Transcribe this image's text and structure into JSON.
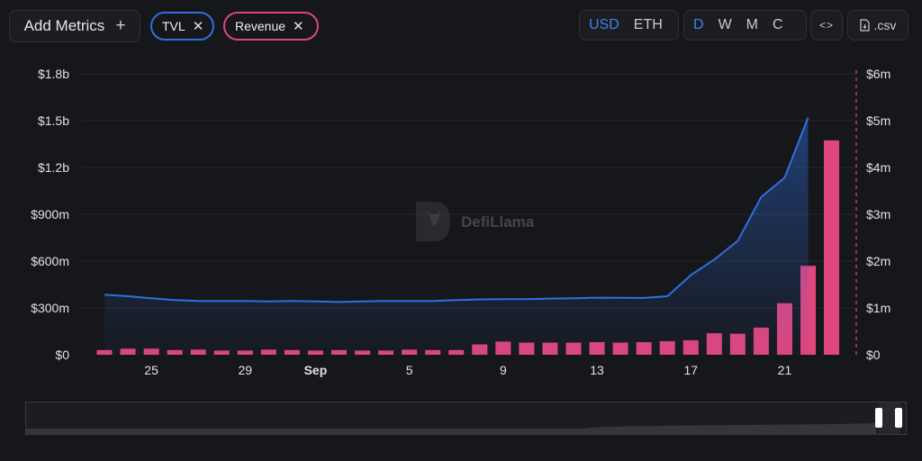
{
  "toolbar": {
    "add_metrics_label": "Add Metrics",
    "plus_glyph": "+",
    "metric_pills": [
      {
        "label": "TVL",
        "color": "#2f6fe0",
        "close": "✕"
      },
      {
        "label": "Revenue",
        "color": "#e0457b",
        "close": "✕"
      }
    ],
    "currency": {
      "options": [
        "USD",
        "ETH"
      ],
      "selected": "USD"
    },
    "period": {
      "options": [
        "D",
        "W",
        "M",
        "C"
      ],
      "selected": "D"
    },
    "embed_label": "<>",
    "csv_label": ".csv"
  },
  "watermark": "DefiLlama",
  "colors": {
    "tvl_line": "#2f6fe0",
    "revenue_bar": "#e0457b",
    "background": "#16171b",
    "grid": "#26272b"
  },
  "chart_data": {
    "type": "bar+line",
    "x_tick_labels": [
      "25",
      "29",
      "Sep",
      "5",
      "9",
      "13",
      "17",
      "21"
    ],
    "y_left": {
      "ticks": [
        "$0",
        "$300m",
        "$600m",
        "$900m",
        "$1.2b",
        "$1.5b",
        "$1.8b"
      ],
      "range": [
        0,
        1800
      ]
    },
    "y_right": {
      "ticks": [
        "$0",
        "$1m",
        "$2m",
        "$3m",
        "$4m",
        "$5m",
        "$6m"
      ],
      "range": [
        0,
        6
      ]
    },
    "series": [
      {
        "name": "TVL",
        "kind": "line",
        "axis": "left",
        "unit": "$m",
        "values": [
          385,
          375,
          362,
          350,
          345,
          345,
          345,
          342,
          345,
          342,
          338,
          342,
          345,
          345,
          345,
          350,
          355,
          356,
          356,
          360,
          362,
          366,
          365,
          364,
          375,
          510,
          610,
          730,
          1010,
          1135,
          1520
        ]
      },
      {
        "name": "Revenue",
        "kind": "bar",
        "axis": "right",
        "unit": "$m",
        "values": [
          0.1,
          0.13,
          0.13,
          0.1,
          0.11,
          0.09,
          0.09,
          0.11,
          0.1,
          0.09,
          0.1,
          0.09,
          0.09,
          0.11,
          0.1,
          0.1,
          0.22,
          0.28,
          0.26,
          0.26,
          0.26,
          0.27,
          0.26,
          0.27,
          0.29,
          0.31,
          0.46,
          0.45,
          0.58,
          1.1,
          1.9,
          4.58
        ]
      }
    ]
  }
}
